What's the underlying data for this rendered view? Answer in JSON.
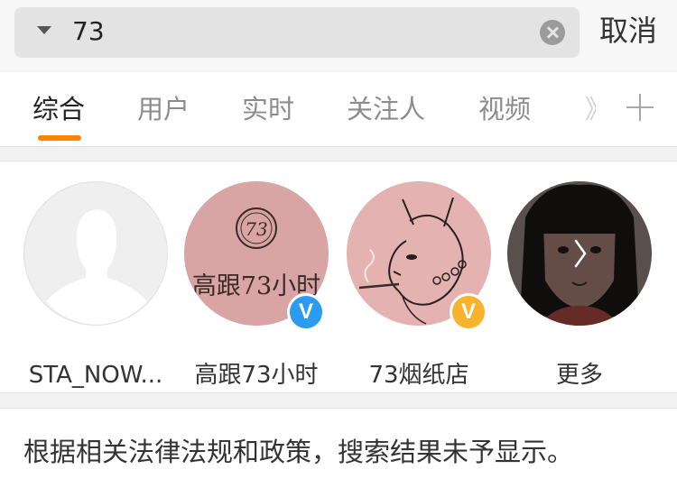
{
  "search": {
    "query": "73",
    "cancel_label": "取消"
  },
  "tabs": [
    {
      "label": "综合",
      "active": true
    },
    {
      "label": "用户",
      "active": false
    },
    {
      "label": "实时",
      "active": false
    },
    {
      "label": "关注人",
      "active": false
    },
    {
      "label": "视频",
      "active": false
    }
  ],
  "tab_overflow_glyph": "》",
  "users": [
    {
      "name": "STA_NOW...",
      "avatar": "placeholder-person",
      "verified": null
    },
    {
      "name": "高跟73小时",
      "avatar": "pink-logo",
      "avatar_text": "高跟73小时",
      "verified": "blue"
    },
    {
      "name": "73烟纸店",
      "avatar": "cat-illustration",
      "verified": "gold"
    },
    {
      "name": "更多",
      "avatar": "girl-illustration",
      "verified": null
    }
  ],
  "badge_glyph": "V",
  "notice": "根据相关法律法规和政策，搜索结果未予显示。",
  "colors": {
    "accent": "#ff8200",
    "verified_blue": "#2b9cf2",
    "verified_gold": "#f8b22b"
  }
}
